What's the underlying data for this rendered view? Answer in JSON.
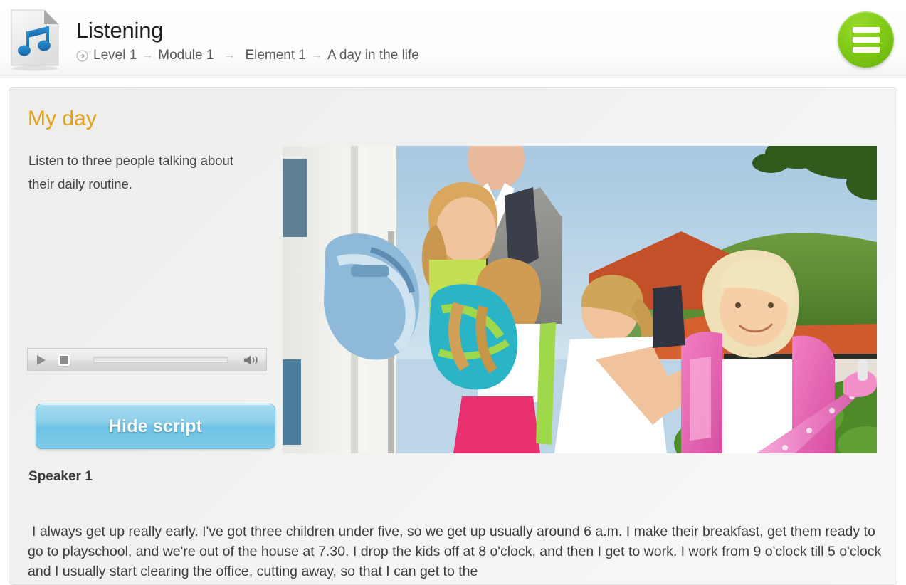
{
  "header": {
    "file_icon": "audio-file-icon",
    "title": "Listening",
    "breadcrumb": {
      "start_icon": "circle-arrow-icon",
      "items": [
        "Level 1",
        "Module 1",
        "Element 1",
        "A day in the life"
      ],
      "separator": "→"
    },
    "menu_button_icon": "hamburger-menu-icon",
    "menu_accent_color": "#7ecb1b"
  },
  "lesson": {
    "title": "My day",
    "title_color": "#e2a017",
    "description": "Listen to three people talking about their daily routine."
  },
  "player": {
    "play_icon": "play-icon",
    "stop_icon": "stop-icon",
    "volume_icon": "volume-speaker-icon",
    "progress_percent": 0
  },
  "script_toggle": {
    "label": "Hide script",
    "accent_color": "#6dc2e3"
  },
  "transcript": {
    "speaker_label": "Speaker 1",
    "text": "I always get up really early. I've got three children under five, so we get up usually around 6 a.m. I make their breakfast, get them ready to go to playschool, and we're out of the house at 7.30. I drop the kids off at 8 o'clock, and then I get to work. I work from 9 o'clock till 5 o'clock and I usually start clearing the office, cutting away, so that I can get to the"
  },
  "photo": {
    "alt": "Children with school backpacks outdoors with adults, red tile roofs and green hills in the background"
  }
}
